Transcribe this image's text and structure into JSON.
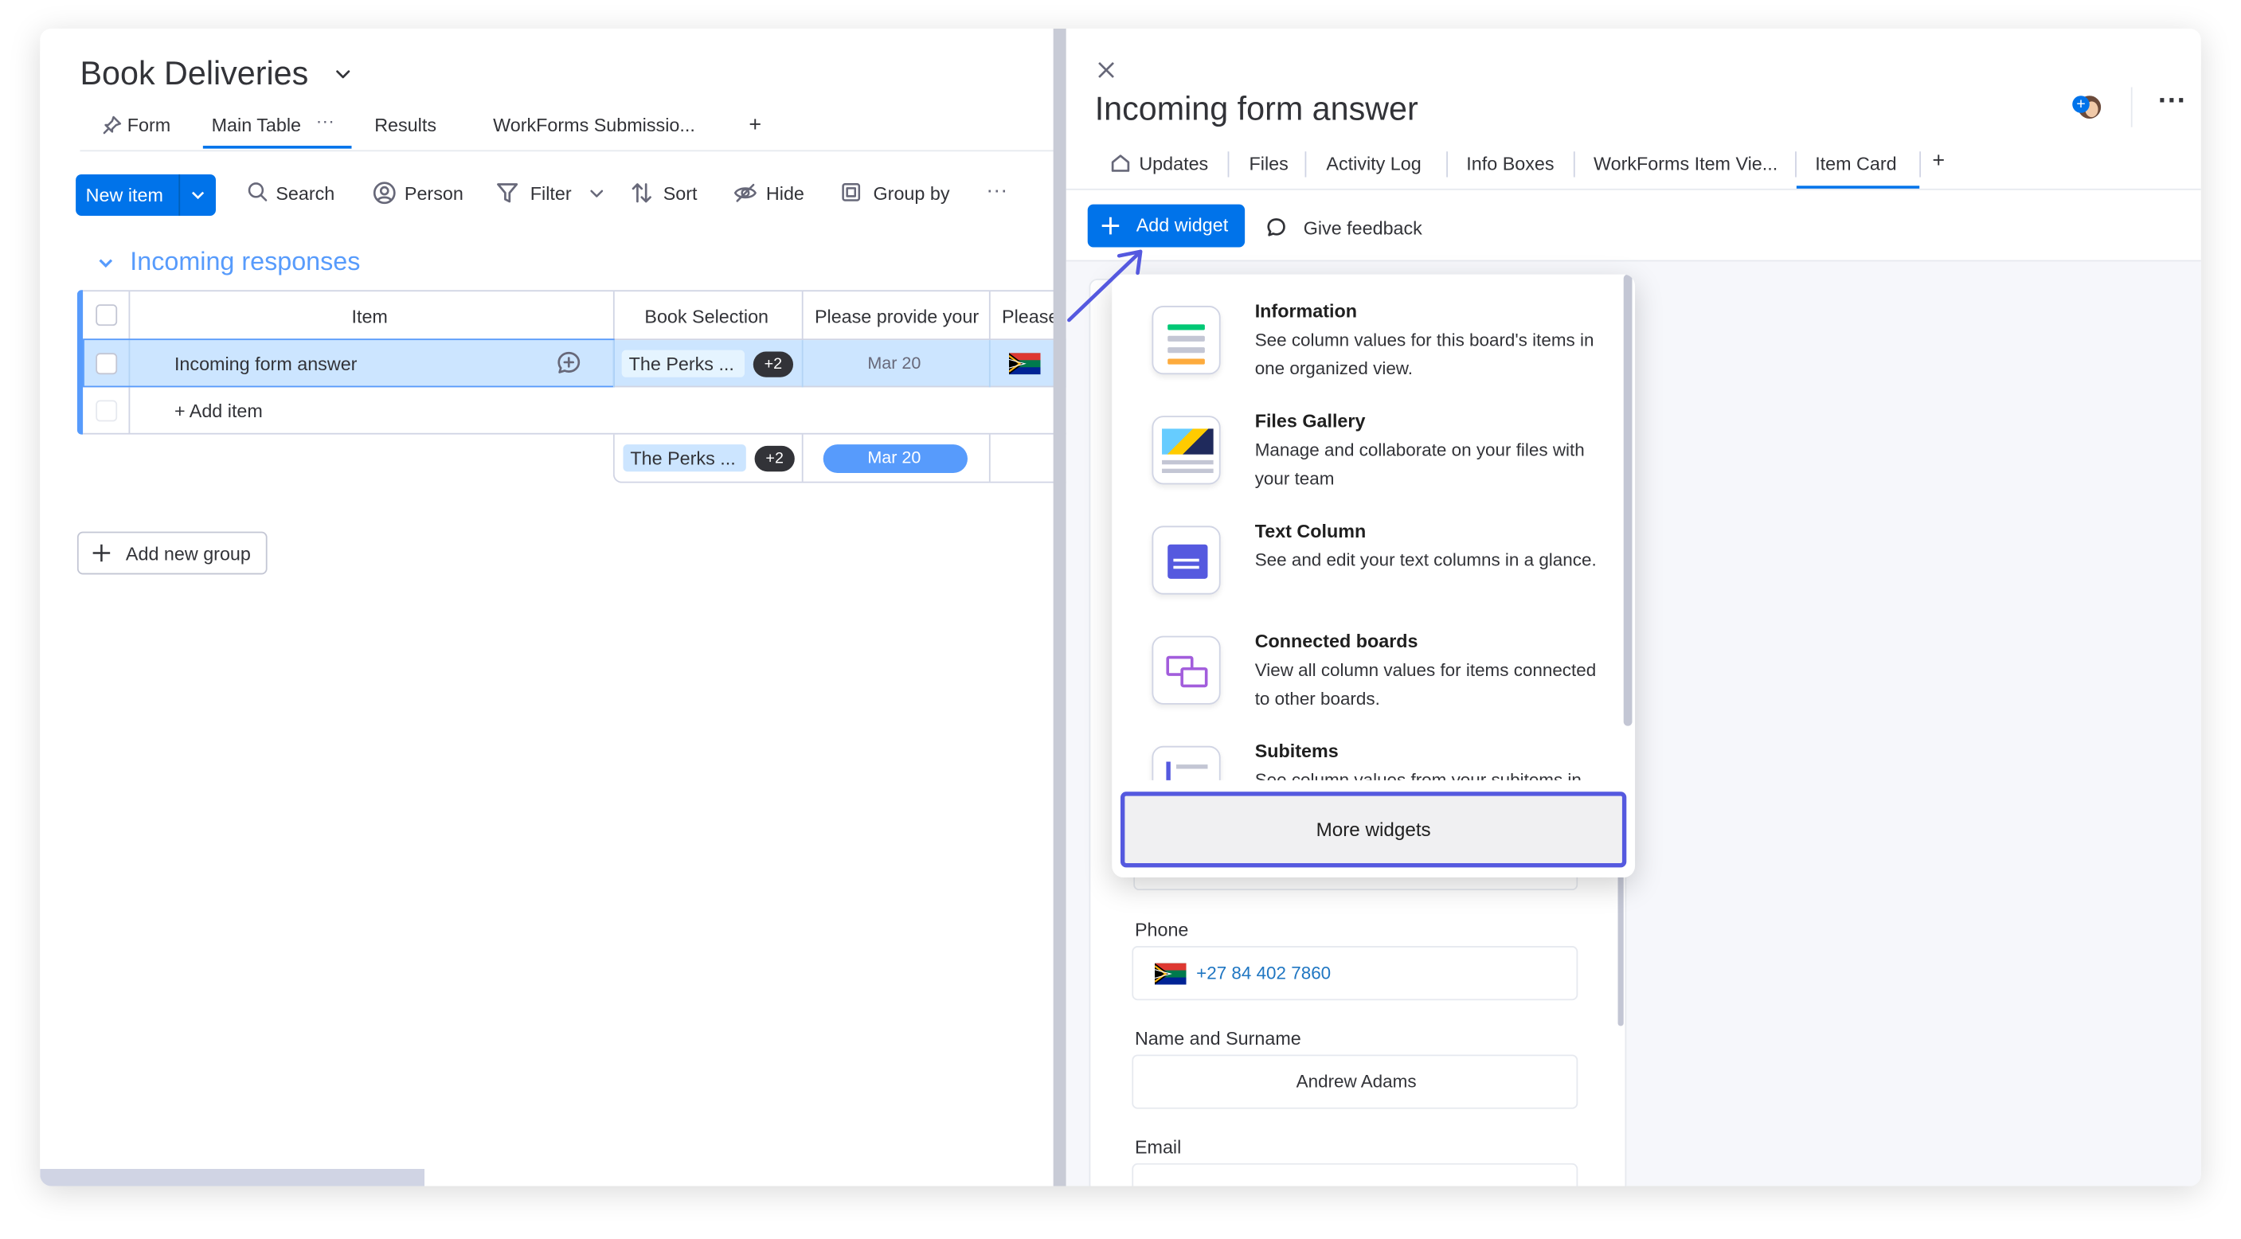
{
  "board": {
    "title": "Book Deliveries",
    "views": [
      "Form",
      "Main Table",
      "Results",
      "WorkForms Submissio..."
    ],
    "add_view": "+"
  },
  "toolbar": {
    "new_item": "New item",
    "search": "Search",
    "person": "Person",
    "filter": "Filter",
    "sort": "Sort",
    "hide": "Hide",
    "group_by": "Group by",
    "more": "···"
  },
  "group": {
    "name": "Incoming responses",
    "color": "#579bfc",
    "columns": [
      "Item",
      "Book Selection",
      "Please provide your",
      "Please"
    ],
    "rows": [
      {
        "item": "Incoming form answer",
        "book": "The Perks ...",
        "book_extra": "+2",
        "date": "Mar 20"
      }
    ],
    "add_item": "+ Add item",
    "summary": {
      "book": "The Perks ...",
      "book_extra": "+2",
      "date": "Mar 20"
    },
    "add_group": "Add new group"
  },
  "panel": {
    "title": "Incoming form answer",
    "tabs": [
      "Updates",
      "Files",
      "Activity Log",
      "Info Boxes",
      "WorkForms Item Vie...",
      "Item Card"
    ],
    "active_tab": "Item Card",
    "add_tab": "+",
    "add_widget": "Add widget",
    "give_feedback": "Give feedback",
    "fields": {
      "phone_label": "Phone",
      "phone_value": "+27 84 402 7860",
      "name_label": "Name and Surname",
      "name_value": "Andrew Adams",
      "email_label": "Email"
    }
  },
  "widgets": [
    {
      "title": "Information",
      "desc": "See column values for this board's items in one organized view.",
      "icon": "information-icon"
    },
    {
      "title": "Files Gallery",
      "desc": "Manage and collaborate on your files with your team",
      "icon": "files-gallery-icon"
    },
    {
      "title": "Text Column",
      "desc": "See and edit your text columns in a glance.",
      "icon": "text-column-icon"
    },
    {
      "title": "Connected boards",
      "desc": "View all column values for items connected to other boards.",
      "icon": "connected-boards-icon"
    },
    {
      "title": "Subitems",
      "desc": "See column values from your subitems in",
      "icon": "subitems-icon"
    }
  ],
  "more_widgets": "More widgets",
  "colors": {
    "primary": "#0073ea",
    "accent": "#5559df",
    "selected_row": "#cce5ff",
    "date_pill": "#579bfc"
  }
}
